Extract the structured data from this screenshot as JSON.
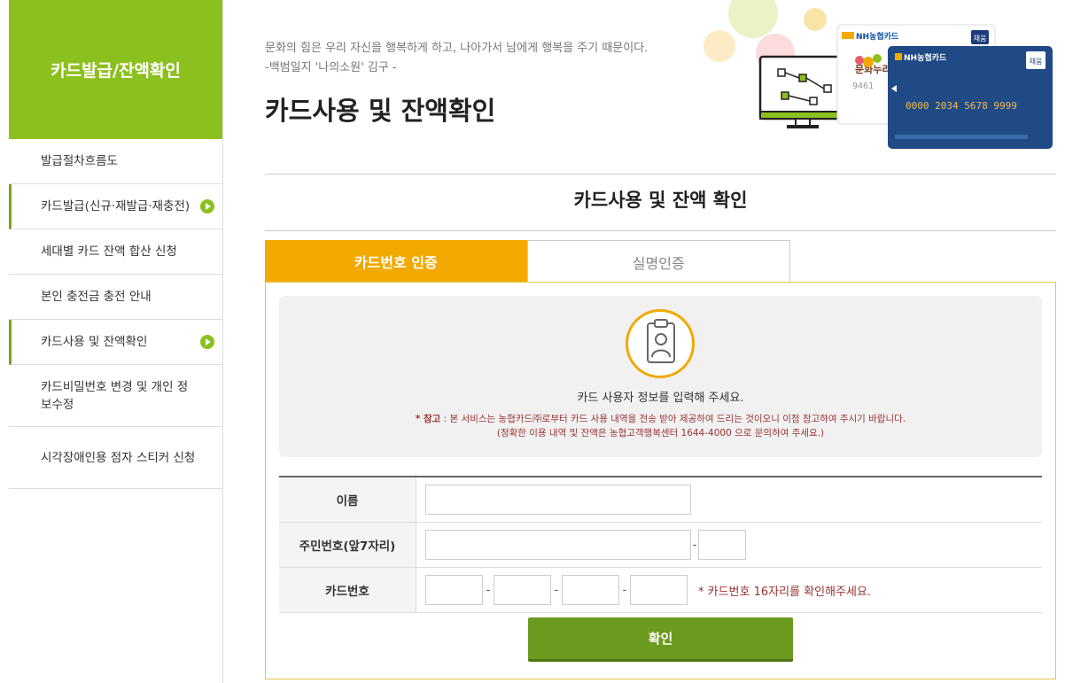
{
  "sidebar": {
    "title": "카드발급/잔액확인",
    "items": [
      {
        "label": "발급절차흐름도",
        "active": false
      },
      {
        "label": "카드발급(신규·재발급·재충전)",
        "active": true
      },
      {
        "label": "세대별 카드 잔액 합산 신청",
        "active": false
      },
      {
        "label": "본인 충전금 충전 안내",
        "active": false
      },
      {
        "label": "카드사용 및 잔액확인",
        "active": true
      },
      {
        "label": "카드비밀번호 변경 및 개인 정보수정",
        "active": false
      },
      {
        "label": "시각장애인용 점자 스티커 신청",
        "active": false
      }
    ]
  },
  "header": {
    "quote_line1": "문화의 힘은 우리 자신을 행복하게 하고, 나아가서 남에게 행복을 주기 때문이다.",
    "quote_line2": "-백범일지 '나의소원' 김구 -",
    "page_title": "카드사용 및 잔액확인"
  },
  "hero": {
    "card_front_brand": "NH농협카드",
    "card_front_number": "0000 2034 5678 9999",
    "card_front_badge": "채움",
    "card_back_brand": "NH농협카드",
    "card_back_title": "문화누리",
    "card_back_badge": "채움",
    "card_back_sub": "9461"
  },
  "section_title": "카드사용 및 잔액 확인",
  "tabs": [
    {
      "label": "카드번호 인증",
      "selected": true
    },
    {
      "label": "실명인증",
      "selected": false
    }
  ],
  "info": {
    "main": "카드 사용자 정보를 입력해 주세요.",
    "note_prefix": "* 참고",
    "note_text": " : 본 서비스는 농협카드㈜로부터 카드 사용 내역을 전송 받아 제공하여 드리는 것이오니 이점 참고하여 주시기 바랍니다.",
    "note_line2": "(정확한 이용 내역 및 잔액은 농협고객행복센터 1644-4000 으로 문의하여 주세요.)"
  },
  "form": {
    "name_label": "이름",
    "name_value": "",
    "rrn_label": "주민번호(앞7자리)",
    "rrn_front_value": "",
    "rrn_back_value": "",
    "rrn_dash": "-",
    "card_label": "카드번호",
    "card_dash": "-",
    "card_parts": [
      "",
      "",
      "",
      ""
    ],
    "card_hint": "* 카드번호 16자리를 확인해주세요.",
    "submit_label": "확인"
  },
  "colors": {
    "sidebar_green": "#8cc01f",
    "tab_orange": "#f2a900",
    "submit_green": "#6b9a1e",
    "note_red": "#9b3232"
  }
}
